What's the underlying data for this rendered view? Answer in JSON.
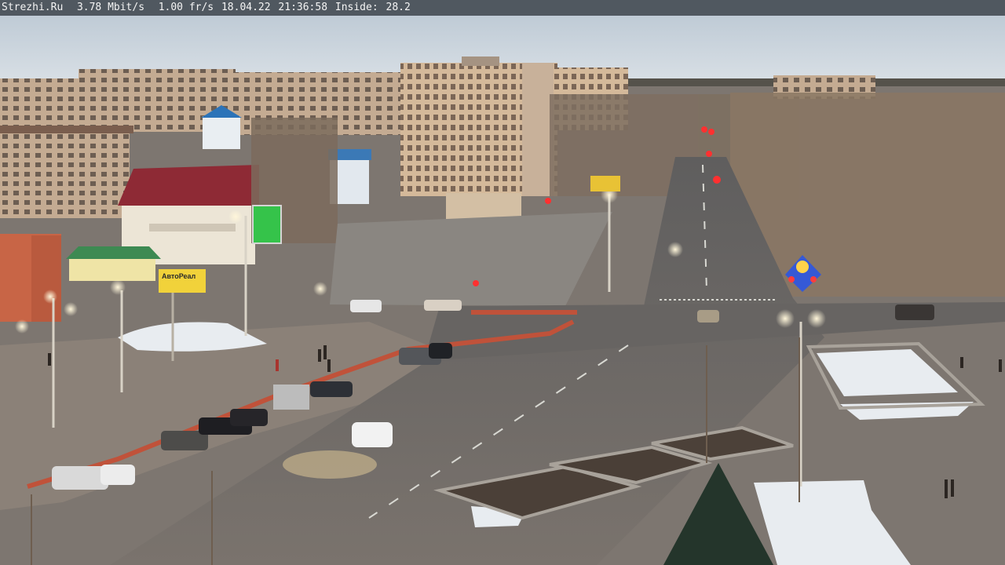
{
  "osd": {
    "site": "Strezhi.Ru",
    "bitrate": "3.78 Mbit/s",
    "framerate": "1.00 fr/s",
    "date": "18.04.22",
    "time": "21:36:58",
    "inside_label": "Inside:",
    "inside_value": "28.2"
  },
  "signs": {
    "billboard_left": "АвтоРеал",
    "led_screen": ""
  },
  "colors": {
    "sky": "#cfd8e0",
    "asphalt": "#6e6b68",
    "snow": "#e9edf1",
    "building_beige": "#c9b59e",
    "red_fence": "#c0523a"
  }
}
